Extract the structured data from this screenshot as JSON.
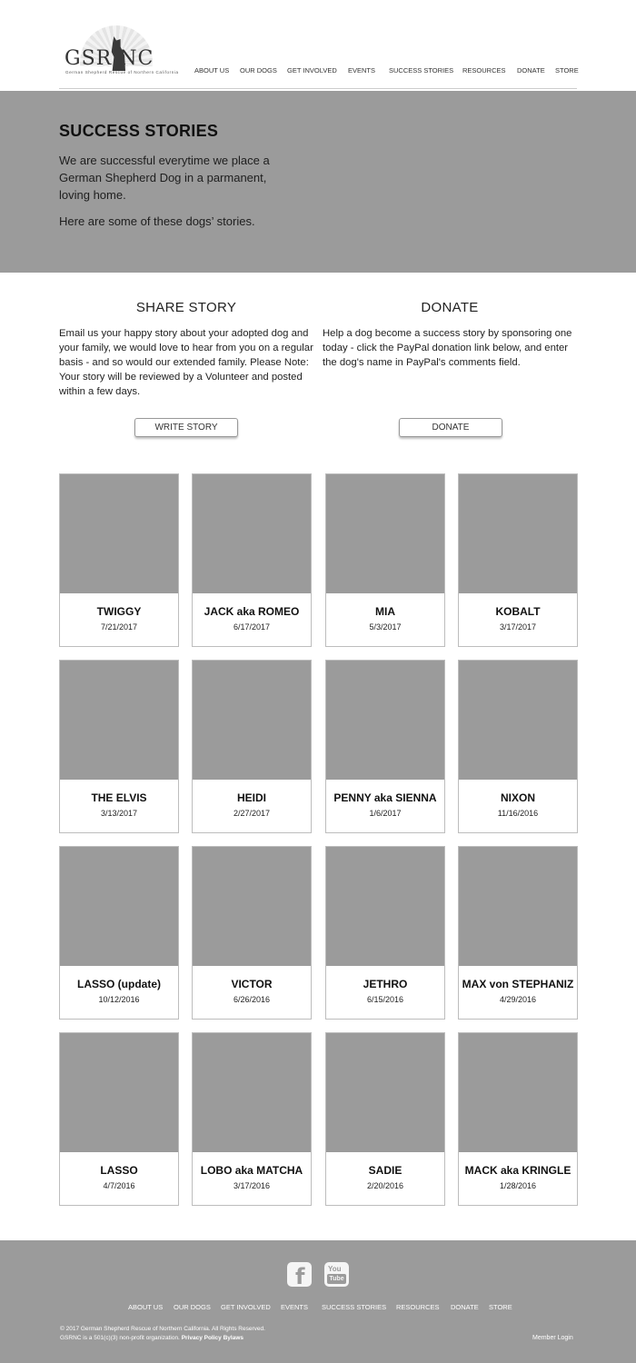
{
  "header": {
    "logo_text": "GSR NC",
    "logo_tagline": "German Shepherd Rescue of Northern California",
    "nav": [
      "ABOUT US",
      "OUR DOGS",
      "GET INVOLVED",
      "EVENTS",
      "SUCCESS STORIES",
      "RESOURCES",
      "DONATE",
      "STORE"
    ]
  },
  "hero": {
    "title": "SUCCESS STORIES",
    "paragraph1": "We are successful everytime we place a German Shepherd Dog in a parmanent, loving home.",
    "paragraph2": "Here are some of these dogs’ stories."
  },
  "share": {
    "title": "SHARE STORY",
    "text": "Email us your happy story about your adopted dog and your family, we would love to hear from you on a regular basis - and so would our extended family. Please Note:  Your story will be reviewed by a Volunteer and posted within a few days.",
    "button": "WRITE STORY"
  },
  "donate": {
    "title": "DONATE",
    "text": "Help a dog become a success story by sponsoring one today - click the PayPal donation link below, and enter the dog's name in PayPal's comments field.",
    "button": "DONATE"
  },
  "stories": [
    {
      "name": "TWIGGY",
      "date": "7/21/2017"
    },
    {
      "name": "JACK aka ROMEO",
      "date": "6/17/2017"
    },
    {
      "name": "MIA",
      "date": "5/3/2017"
    },
    {
      "name": "KOBALT",
      "date": "3/17/2017"
    },
    {
      "name": "THE ELVIS",
      "date": "3/13/2017"
    },
    {
      "name": "HEIDI",
      "date": "2/27/2017"
    },
    {
      "name": "PENNY aka SIENNA",
      "date": "1/6/2017"
    },
    {
      "name": "NIXON",
      "date": "11/16/2016"
    },
    {
      "name": "LASSO (update)",
      "date": "10/12/2016"
    },
    {
      "name": "VICTOR",
      "date": "6/26/2016"
    },
    {
      "name": "JETHRO",
      "date": "6/15/2016"
    },
    {
      "name": "MAX von STEPHANIZ",
      "date": "4/29/2016"
    },
    {
      "name": "LASSO",
      "date": "4/7/2016"
    },
    {
      "name": "LOBO aka MATCHA",
      "date": "3/17/2016"
    },
    {
      "name": "SADIE",
      "date": "2/20/2016"
    },
    {
      "name": "MACK aka KRINGLE",
      "date": "1/28/2016"
    }
  ],
  "footer": {
    "facebook_icon": "facebook-icon",
    "youtube_icon": "youtube-icon",
    "youtube_you": "You",
    "youtube_tube": "Tube",
    "nav": [
      "ABOUT US",
      "OUR DOGS",
      "GET INVOLVED",
      "EVENTS",
      "SUCCESS STORIES",
      "RESOURCES",
      "DONATE",
      "STORE"
    ],
    "copyright": "©  2017 German Shepherd Rescue of Northern California. All Rights Reserved.",
    "nonprofit": "GSRNC is a 501(c)(3) non-profit organization.",
    "privacy": "Privacy Policy",
    "bylaws": "Bylaws",
    "member_login": "Member Login"
  }
}
